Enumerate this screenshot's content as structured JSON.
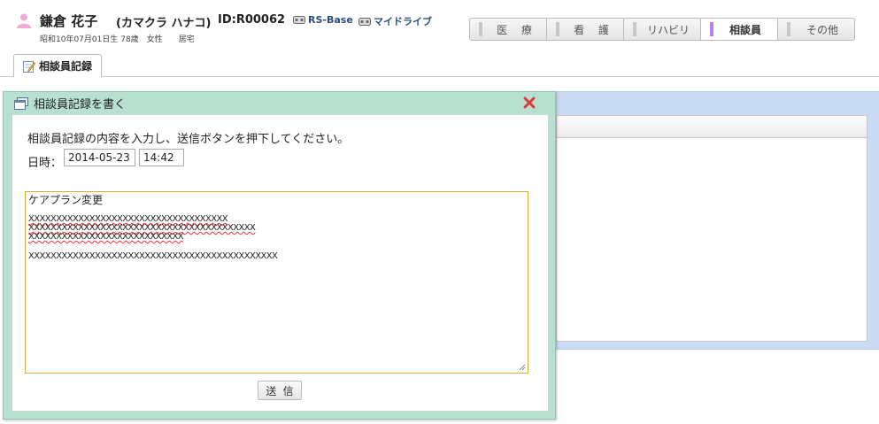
{
  "patient": {
    "name": "鎌倉 花子",
    "kana": "(カマクラ ハナコ)",
    "id": "ID:R00062",
    "details": "昭和10年07月01日生 78歳　女性　　居宅"
  },
  "links": [
    {
      "label": "RS-Base",
      "icon": "drive-icon"
    },
    {
      "label": "マイドライブ",
      "icon": "drive-icon"
    }
  ],
  "categories": {
    "medical": "医 療",
    "nursing": "看 護",
    "rehab": "リハビリ",
    "counselor": "相談員",
    "other": "その他",
    "active": "相談員"
  },
  "page_tab": {
    "label": "相談員記録",
    "icon": "notepad-pencil-icon"
  },
  "dialog": {
    "title": "相談員記録を書く",
    "title_icon": "window-icon",
    "close_icon": "close-x-icon",
    "instruction": "相談員記録の内容を入力し、送信ボタンを押下してください。",
    "datetime_label": "日時：",
    "date_value": "2014-05-23",
    "time_value": "14:42",
    "text_lines": [
      "ケアプラン変更",
      "XXXXXXXXXXXXXXXXXXXXXXXXXXXXXXXXXXXX",
      "XXXXXXXXXXXXXXXXXXXXXXXXXXXXXXXXXXXXXXXXX",
      "XXXXXXXXXXXXXXXXXXXXXXXXXXXX",
      "XXXXXXXXXXXXXXXXXXXXXXXXXXXXXXXXXXXXXXXXXXXXX"
    ],
    "send_label": "送信"
  },
  "colors": {
    "dialog_bg": "#b7e0d1",
    "textarea_border": "#e0a640",
    "active_category_bar": "#b383e6",
    "link_text": "#2a4f7e",
    "close_red": "#e03a3a",
    "bg_panel": "#c9dcf3"
  }
}
